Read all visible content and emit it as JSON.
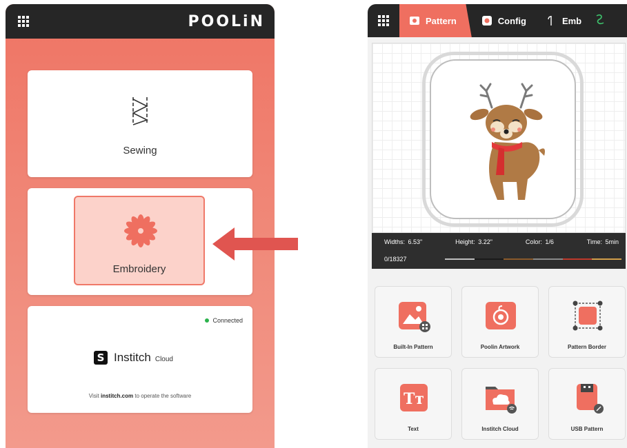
{
  "left_app": {
    "logo": "POOLiN",
    "sewing_label": "Sewing",
    "embroidery_label": "Embroidery",
    "cloud": {
      "status": "Connected",
      "brand_name": "Institch",
      "brand_suffix": "Cloud",
      "visit_prefix": "Visit ",
      "visit_link": "institch.com",
      "visit_suffix": " to operate the software"
    }
  },
  "right_app": {
    "tabs": [
      {
        "label": "Pattern",
        "icon": "pattern-icon",
        "active": true
      },
      {
        "label": "Config",
        "icon": "config-icon",
        "active": false
      },
      {
        "label": "Emb",
        "icon": "needle-icon",
        "active": false
      }
    ],
    "info": {
      "width_label": "Widths:",
      "width_value": "6.53\"",
      "height_label": "Height:",
      "height_value": "3.22\"",
      "color_label": "Color:",
      "color_value": "1/6",
      "time_label": "Time:",
      "time_value": "5min",
      "stitch_count": "0/18327"
    },
    "thread_colors": [
      "#bfbfbf",
      "#1a1a1a",
      "#8b5a2b",
      "#8a8a8a",
      "#c0392b",
      "#d4a04a"
    ],
    "buttons": [
      {
        "label": "Built-In Pattern",
        "icon": "image-icon"
      },
      {
        "label": "Poolin Artwork",
        "icon": "artwork-icon"
      },
      {
        "label": "Pattern Border",
        "icon": "border-icon"
      },
      {
        "label": "Text",
        "icon": "text-icon"
      },
      {
        "label": "Institch Cloud",
        "icon": "cloud-folder-icon"
      },
      {
        "label": "USB Pattern",
        "icon": "usb-icon"
      }
    ]
  },
  "colors": {
    "accent": "#ef6f60",
    "dark_bar": "#262626",
    "connected": "#2bb24c"
  }
}
